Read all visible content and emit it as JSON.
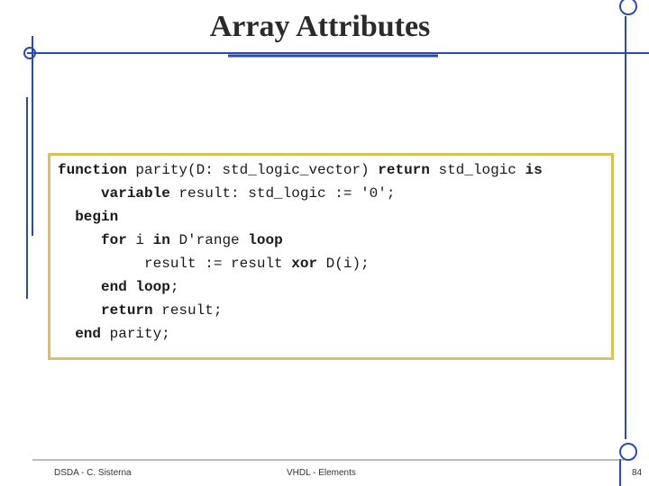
{
  "slide": {
    "title": "Array Attributes"
  },
  "code": {
    "lines": [
      [
        {
          "t": "function",
          "kw": true
        },
        {
          "t": " parity(D: std_logic_vector) ",
          "kw": false
        },
        {
          "t": "return",
          "kw": true
        },
        {
          "t": " std_logic ",
          "kw": false
        },
        {
          "t": "is",
          "kw": true
        }
      ],
      [
        {
          "t": "     ",
          "kw": false
        },
        {
          "t": "variable",
          "kw": true
        },
        {
          "t": " result: std_logic := '0';",
          "kw": false
        }
      ],
      [
        {
          "t": "  ",
          "kw": false
        },
        {
          "t": "begin",
          "kw": true
        }
      ],
      [
        {
          "t": "     ",
          "kw": false
        },
        {
          "t": "for",
          "kw": true
        },
        {
          "t": " i ",
          "kw": false
        },
        {
          "t": "in",
          "kw": true
        },
        {
          "t": " D'range ",
          "kw": false
        },
        {
          "t": "loop",
          "kw": true
        }
      ],
      [
        {
          "t": "          result := result ",
          "kw": false
        },
        {
          "t": "xor",
          "kw": true
        },
        {
          "t": " D(i);",
          "kw": false
        }
      ],
      [
        {
          "t": "     ",
          "kw": false
        },
        {
          "t": "end loop",
          "kw": true
        },
        {
          "t": ";",
          "kw": false
        }
      ],
      [
        {
          "t": "     ",
          "kw": false
        },
        {
          "t": "return",
          "kw": true
        },
        {
          "t": " result;",
          "kw": false
        }
      ],
      [
        {
          "t": "  ",
          "kw": false
        },
        {
          "t": "end",
          "kw": true
        },
        {
          "t": " parity;",
          "kw": false
        }
      ]
    ]
  },
  "footer": {
    "left": "DSDA - C. Sisterna",
    "middle": "VHDL - Elements",
    "page": "84"
  },
  "colors": {
    "accent": "#2e4aa8",
    "code_border": "#d8c25a"
  }
}
